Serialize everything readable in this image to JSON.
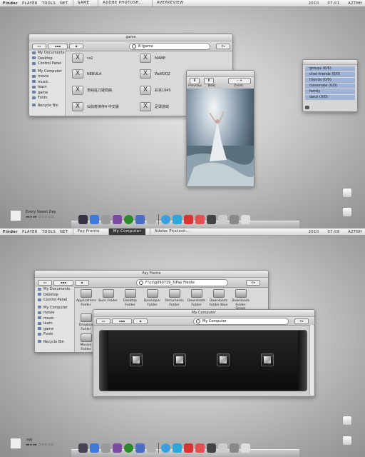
{
  "top": {
    "menubar": {
      "brand": "Finder",
      "menus": [
        "PLAYER",
        "TOOLS",
        "NET"
      ],
      "tasks": [
        "GAME",
        "ADOBE PHOTOSH...",
        "AVEPREVIEW"
      ],
      "right": [
        "2010",
        "07:01",
        "AZTBH"
      ]
    },
    "finder": {
      "title": "game",
      "address": "E:\\game",
      "sidebar": [
        "My Documents",
        "Desktop",
        "Control Panel",
        "My Computer",
        "movie",
        "music",
        "learn",
        "game",
        "Fonts",
        "Recycle Bin"
      ],
      "items": [
        "cs2",
        "MAME",
        "NEBULA",
        "WolfDQ2",
        "単純狂刀疑問曲",
        "彩京1945",
        "仙剑奇侠传4 中文版",
        "足球游戏"
      ]
    },
    "preview": {
      "buttons": [
        "Previous",
        "Next",
        "Zoom"
      ]
    },
    "buddies": [
      "groups (6/6)",
      "chat friends (0/0)",
      "friends (0/0)",
      "classmate (0/0)",
      "family",
      "darzi (0/0)"
    ],
    "player": {
      "title": "Every Sweet Day",
      "stars": "☆☆☆☆☆"
    }
  },
  "bottom": {
    "menubar": {
      "brand": "Finder",
      "menus": [
        "PLAYER",
        "TOOLS",
        "NET"
      ],
      "tasks": [
        "Pay Frente",
        "My Computer",
        "Adobe Photosh..."
      ],
      "right": [
        "2010",
        "07:09",
        "AZTBH"
      ]
    },
    "back_window": {
      "title": "Pay Frente",
      "address": "F:\\cc\\g090719_3\\Pay Frente",
      "sidebar": [
        "My Documents",
        "Desktop",
        "Control Panel",
        "My Computer",
        "movie",
        "music",
        "learn",
        "game",
        "Fonts",
        "Recycle Bin"
      ],
      "folders": [
        "Applications Folder",
        "Burn Folder",
        "Desktop Folder",
        "Developer Folder",
        "Documents Folder",
        "Downloads Folder",
        "Downloads Folder Blue",
        "Downloads Folder Green",
        "Dropbox Folder",
        "Movies Folder"
      ]
    },
    "front_window": {
      "title": "My Computer",
      "address": "My Computer"
    },
    "player": {
      "title": "가하",
      "stars": "☆☆☆☆☆"
    }
  },
  "colors": {
    "accent": "#3a3a3a",
    "buddy_row": "#9fb4d6",
    "selection": "#dcdcdc"
  }
}
